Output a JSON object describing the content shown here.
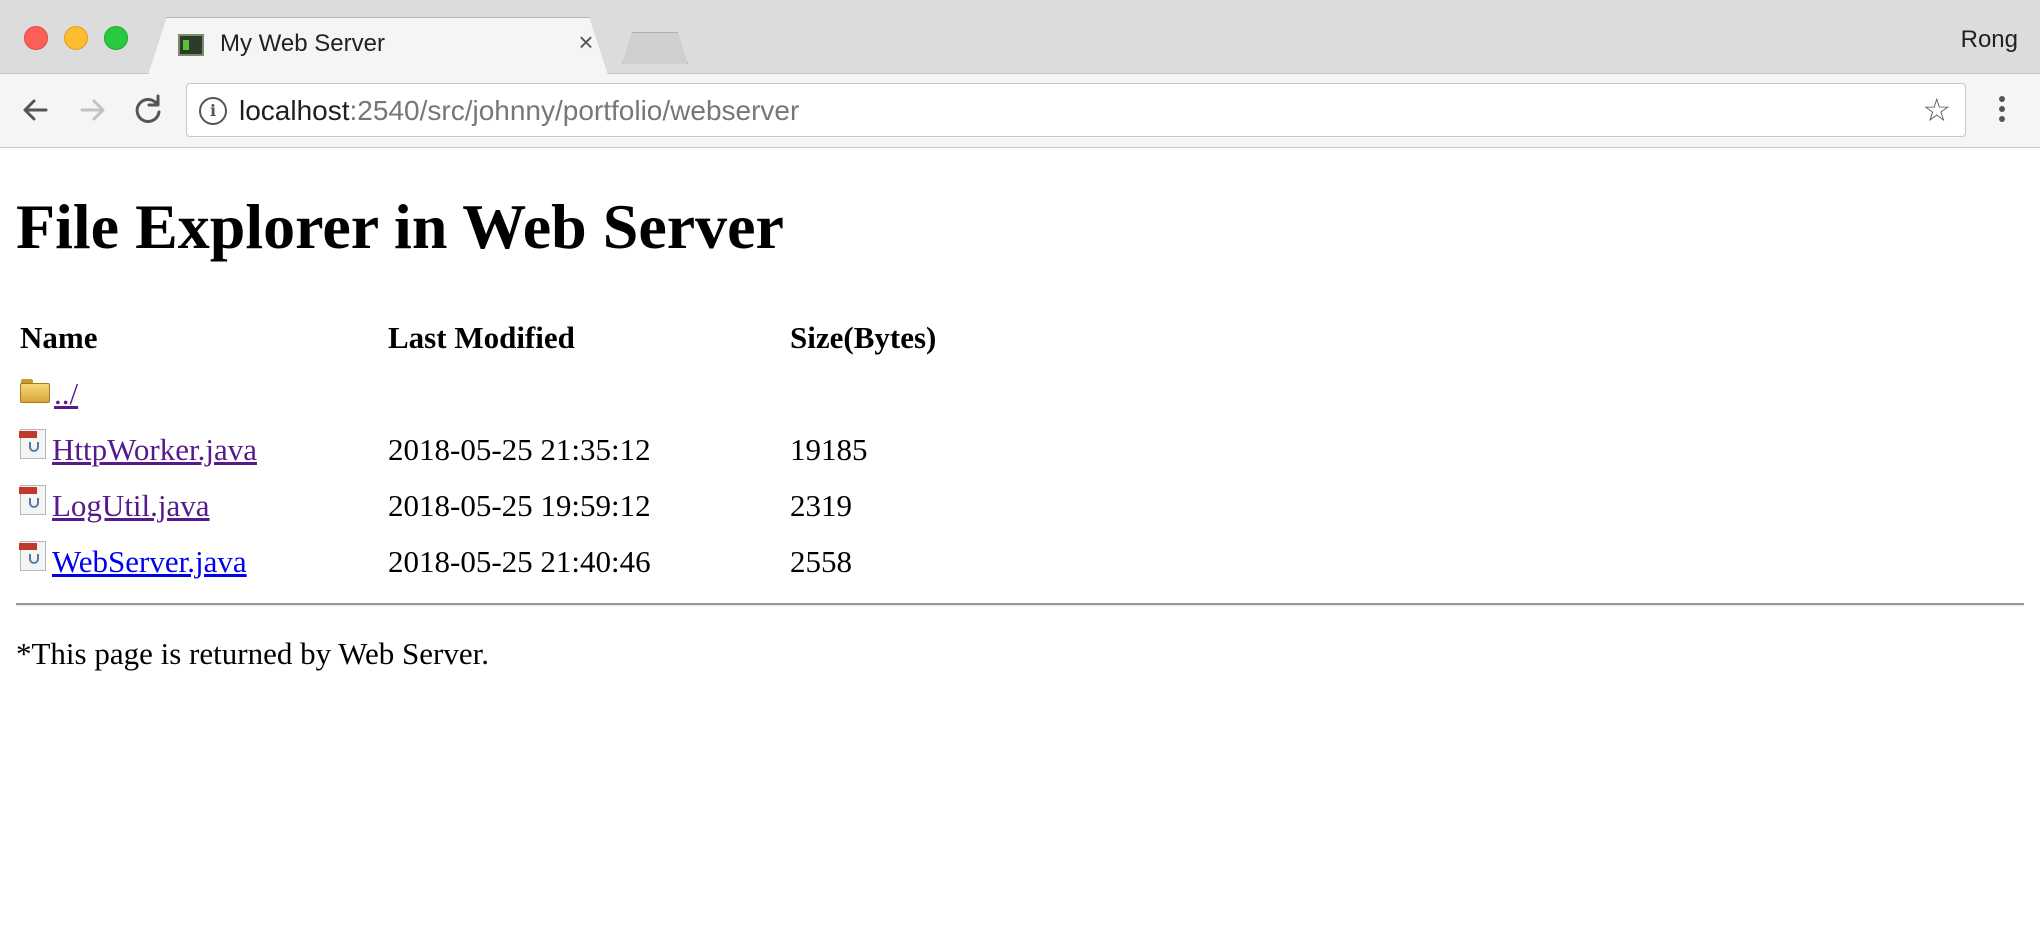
{
  "browser": {
    "tab_title": "My Web Server",
    "tab_close": "×",
    "profile_name": "Rong",
    "url_host": "localhost",
    "url_rest": ":2540/src/johnny/portfolio/webserver",
    "star_icon": "☆"
  },
  "page": {
    "heading": "File Explorer in Web Server",
    "columns": {
      "name": "Name",
      "last_modified": "Last Modified",
      "size": "Size(Bytes)"
    },
    "files": [
      {
        "name": "../",
        "icon": "folder-icon",
        "last_modified": "",
        "size": ""
      },
      {
        "name": "HttpWorker.java",
        "icon": "java-file-icon",
        "last_modified": "2018-05-25 21:35:12",
        "size": "19185"
      },
      {
        "name": "LogUtil.java",
        "icon": "java-file-icon",
        "last_modified": "2018-05-25 19:59:12",
        "size": "2319"
      },
      {
        "name": "WebServer.java",
        "icon": "java-file-icon",
        "last_modified": "2018-05-25 21:40:46",
        "size": "2558"
      }
    ],
    "footer": "*This page is returned by Web Server."
  },
  "colors": {
    "visited_link": "#551a8b",
    "unvisited_link": "#0000ee",
    "chrome_bg": "#dcdcdc"
  }
}
